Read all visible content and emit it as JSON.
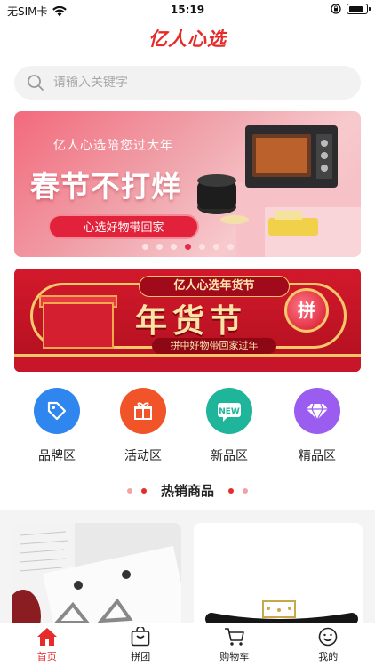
{
  "status": {
    "carrier": "无SIM卡",
    "time": "15:19",
    "battery_level": 0.8
  },
  "header": {
    "brand_text": "亿人心选"
  },
  "search": {
    "placeholder": "请输入关键字"
  },
  "banner": {
    "slogan": "亿人心选陪您过大年",
    "title": "春节不打烊",
    "pill": "心选好物带回家",
    "slide_count": 7,
    "active_slide_index": 3
  },
  "promo": {
    "tag": "亿人心选年货节",
    "title": "年货节",
    "subtitle": "拼中好物带回家过年",
    "badge": "拼"
  },
  "categories": [
    {
      "label": "品牌区",
      "icon": "tag-icon",
      "color": "#2f86ee"
    },
    {
      "label": "活动区",
      "icon": "gift-icon",
      "color": "#f2542a"
    },
    {
      "label": "新品区",
      "icon": "new-icon",
      "color": "#1fb59a"
    },
    {
      "label": "精品区",
      "icon": "diamond-icon",
      "color": "#9b5cf0"
    }
  ],
  "section": {
    "title": "热销商品"
  },
  "tabbar": {
    "items": [
      {
        "label": "首页",
        "icon": "home-icon",
        "active": true
      },
      {
        "label": "拼团",
        "icon": "bag-icon",
        "active": false
      },
      {
        "label": "购物车",
        "icon": "cart-icon",
        "active": false
      },
      {
        "label": "我的",
        "icon": "user-icon",
        "active": false
      }
    ]
  },
  "colors": {
    "accent": "#e62b2b"
  }
}
